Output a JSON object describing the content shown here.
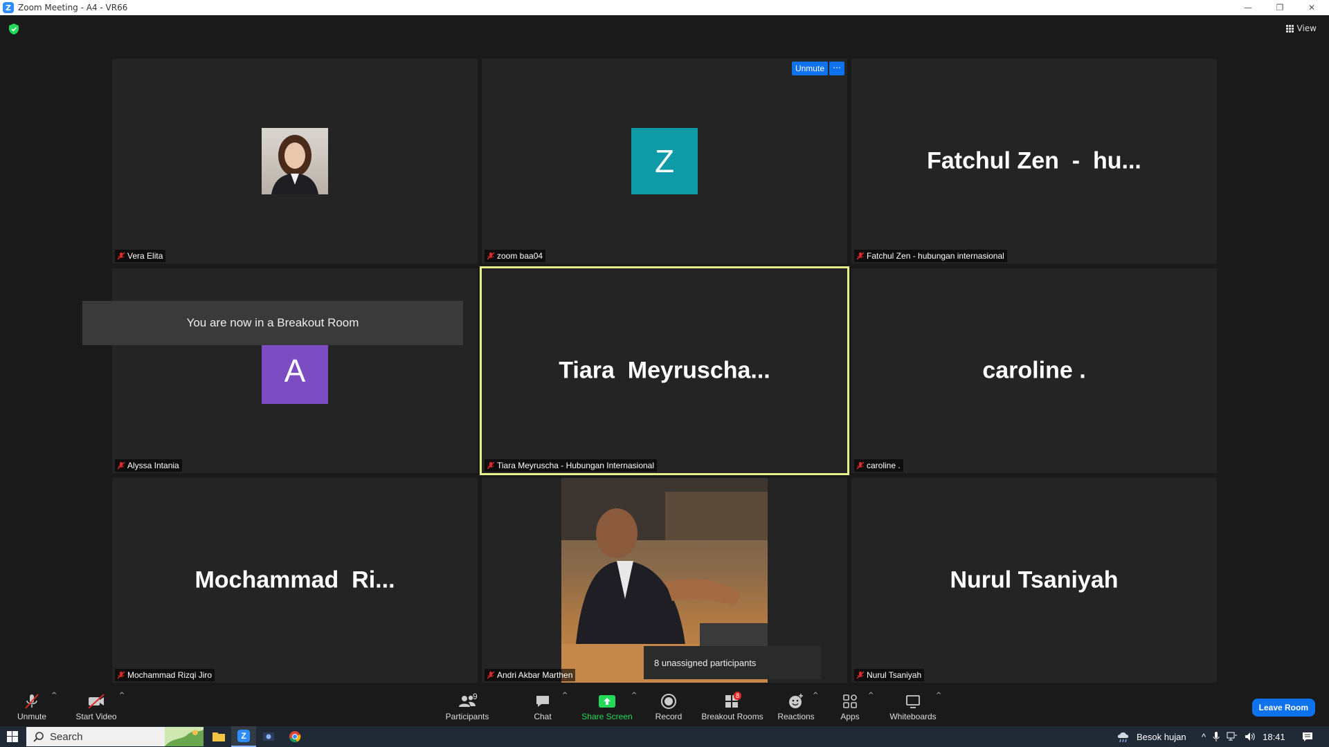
{
  "window": {
    "title": "Zoom Meeting - A4 - VR66"
  },
  "header": {
    "view_label": "View"
  },
  "tiles": [
    {
      "name": "Vera Elita",
      "display": "",
      "type": "photo"
    },
    {
      "name": "zoom baa04",
      "display": "Z",
      "type": "letter",
      "color": "#0e9aa7"
    },
    {
      "name": "Fatchul Zen - hubungan internasional",
      "display": "Fatchul Zen  -  hu...",
      "type": "name"
    },
    {
      "name": "Alyssa Intania",
      "display": "A",
      "type": "letter",
      "color": "#7b4cc2"
    },
    {
      "name": "Tiara Meyruscha - Hubungan Internasional",
      "display": "Tiara  Meyruscha...",
      "type": "name",
      "active": true
    },
    {
      "name": "caroline .",
      "display": "caroline .",
      "type": "name"
    },
    {
      "name": "Mochammad Rizqi Jiro",
      "display": "Mochammad  Ri...",
      "type": "name"
    },
    {
      "name": "Andri Akbar Marthen",
      "display": "",
      "type": "photo"
    },
    {
      "name": "Nurul Tsaniyah",
      "display": "Nurul Tsaniyah",
      "type": "name"
    }
  ],
  "tile_controls": {
    "unmute_label": "Unmute",
    "more_label": "···"
  },
  "notifications": {
    "breakout_toast": "You are now in a Breakout Room",
    "unassigned_tooltip": "8 unassigned participants"
  },
  "toolbar": {
    "unmute": "Unmute",
    "start_video": "Start Video",
    "participants": "Participants",
    "participants_count": "9",
    "chat": "Chat",
    "share_screen": "Share Screen",
    "record": "Record",
    "breakout_rooms": "Breakout Rooms",
    "breakout_badge": "8",
    "reactions": "Reactions",
    "apps": "Apps",
    "whiteboards": "Whiteboards",
    "leave_room": "Leave Room"
  },
  "taskbar": {
    "search_label": "Search",
    "weather": "Besok hujan",
    "clock": "18:41"
  },
  "colors": {
    "accent_blue": "#0e72ed",
    "active_speaker_border": "#e7f089",
    "share_green": "#23d959",
    "mute_red": "#e02828"
  }
}
